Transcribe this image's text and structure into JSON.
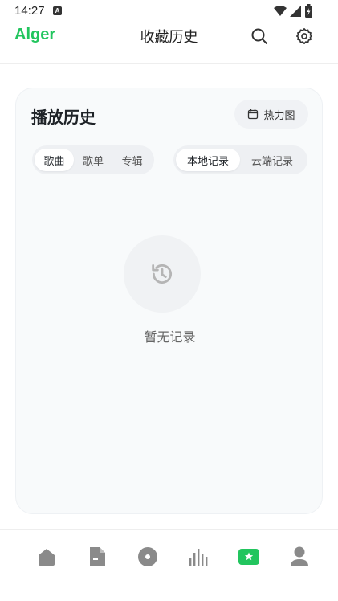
{
  "status_bar": {
    "time": "14:27",
    "notification_glyph": "A"
  },
  "header": {
    "logo": "Alger",
    "title": "收藏历史"
  },
  "card": {
    "title": "播放历史",
    "heatmap_label": "热力图",
    "type_tabs": [
      {
        "label": "歌曲",
        "active": true
      },
      {
        "label": "歌单",
        "active": false
      },
      {
        "label": "专辑",
        "active": false
      }
    ],
    "source_tabs": [
      {
        "label": "本地记录",
        "active": true
      },
      {
        "label": "云端记录",
        "active": false
      }
    ],
    "empty_text": "暂无记录"
  },
  "bottom_nav": [
    {
      "icon": "home-icon",
      "active": false
    },
    {
      "icon": "document-icon",
      "active": false
    },
    {
      "icon": "disc-icon",
      "active": false
    },
    {
      "icon": "chart-bars-icon",
      "active": false
    },
    {
      "icon": "favorites-icon",
      "active": true
    },
    {
      "icon": "user-icon",
      "active": false
    }
  ],
  "colors": {
    "brand": "#22c55e",
    "icon_gray": "#8a8a8a",
    "text_muted": "#666666"
  }
}
